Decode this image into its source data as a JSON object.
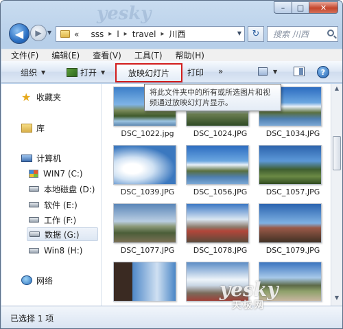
{
  "window": {
    "caption_buttons": {
      "minimize": "–",
      "maximize": "□",
      "close": "✕"
    },
    "watermark_top": "yesky"
  },
  "nav": {
    "back_icon": "back-arrow-icon",
    "forward_icon": "forward-arrow-icon",
    "breadcrumb": [
      "«",
      "sss",
      "l",
      "travel",
      "川西"
    ],
    "search_placeholder": "搜索 川西"
  },
  "menubar": {
    "items": [
      "文件(F)",
      "编辑(E)",
      "查看(V)",
      "工具(T)",
      "帮助(H)"
    ]
  },
  "toolbar": {
    "organize": "组织",
    "open": "打开",
    "slideshow": "放映幻灯片",
    "print": "打印",
    "more": "»"
  },
  "tooltip": {
    "line1": "将此文件夹中的所有或所选图片和视",
    "line2": "频通过放映幻灯片显示。"
  },
  "sidebar": {
    "favorites": "收藏夹",
    "libraries": "库",
    "computer": "计算机",
    "drives": [
      "WIN7 (C:)",
      "本地磁盘 (D:)",
      "软件 (E:)",
      "工作 (F:)",
      "数据 (G:)",
      "Win8 (H:)"
    ],
    "selected_drive": "数据 (G:)",
    "network": "网络"
  },
  "files": [
    "DSC_1022.jpg",
    "DSC_1024.JPG",
    "DSC_1034.JPG",
    "DSC_1039.JPG",
    "DSC_1056.JPG",
    "DSC_1057.JPG",
    "DSC_1077.JPG",
    "DSC_1078.JPG",
    "DSC_1079.JPG",
    "",
    "",
    ""
  ],
  "watermark": {
    "brand": "yesky",
    "sub": "天极网"
  },
  "status": {
    "text": "已选择 1 项"
  }
}
